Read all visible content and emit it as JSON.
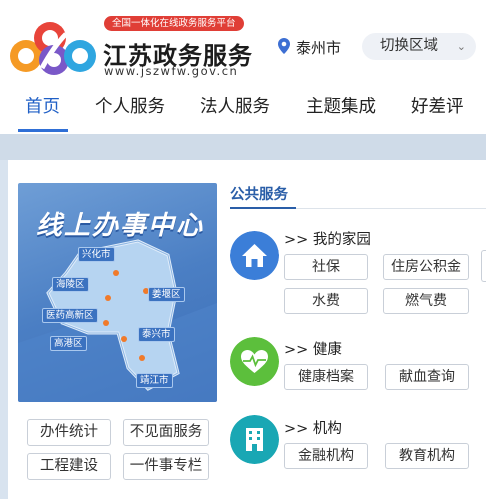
{
  "header": {
    "slogan": "全国一体化在线政务服务平台",
    "site_name": "江苏政务服务",
    "site_url": "www.jszwfw.gov.cn",
    "city": "泰州市",
    "switch_region": "切换区域"
  },
  "nav": {
    "items": [
      "首页",
      "个人服务",
      "法人服务",
      "主题集成",
      "好差评"
    ],
    "active": "首页"
  },
  "banner": {
    "title": "线上办事中心",
    "districts": [
      "兴化市",
      "海陵区",
      "医药高新区",
      "姜堰区",
      "高港区",
      "泰兴市",
      "靖江市"
    ]
  },
  "quick_tiles": [
    "办件统计",
    "不见面服务",
    "工程建设",
    "一件事专栏"
  ],
  "public_services": {
    "title": "公共服务",
    "categories": [
      {
        "label": ">> 我的家园",
        "icon": "home-icon",
        "color": "#3b7ed8",
        "services": [
          "社保",
          "住房公积金",
          "水费",
          "燃气费"
        ]
      },
      {
        "label": ">> 健康",
        "icon": "heart-pulse-icon",
        "color": "#5cbf3c",
        "services": [
          "健康档案",
          "献血查询"
        ]
      },
      {
        "label": ">> 机构",
        "icon": "building-icon",
        "color": "#19a7b4",
        "services": [
          "金融机构",
          "教育机构"
        ]
      }
    ]
  },
  "colors": {
    "accent": "#1f5fc6",
    "slogan_bg": "#e03e36",
    "band": "#d8e3ef"
  }
}
